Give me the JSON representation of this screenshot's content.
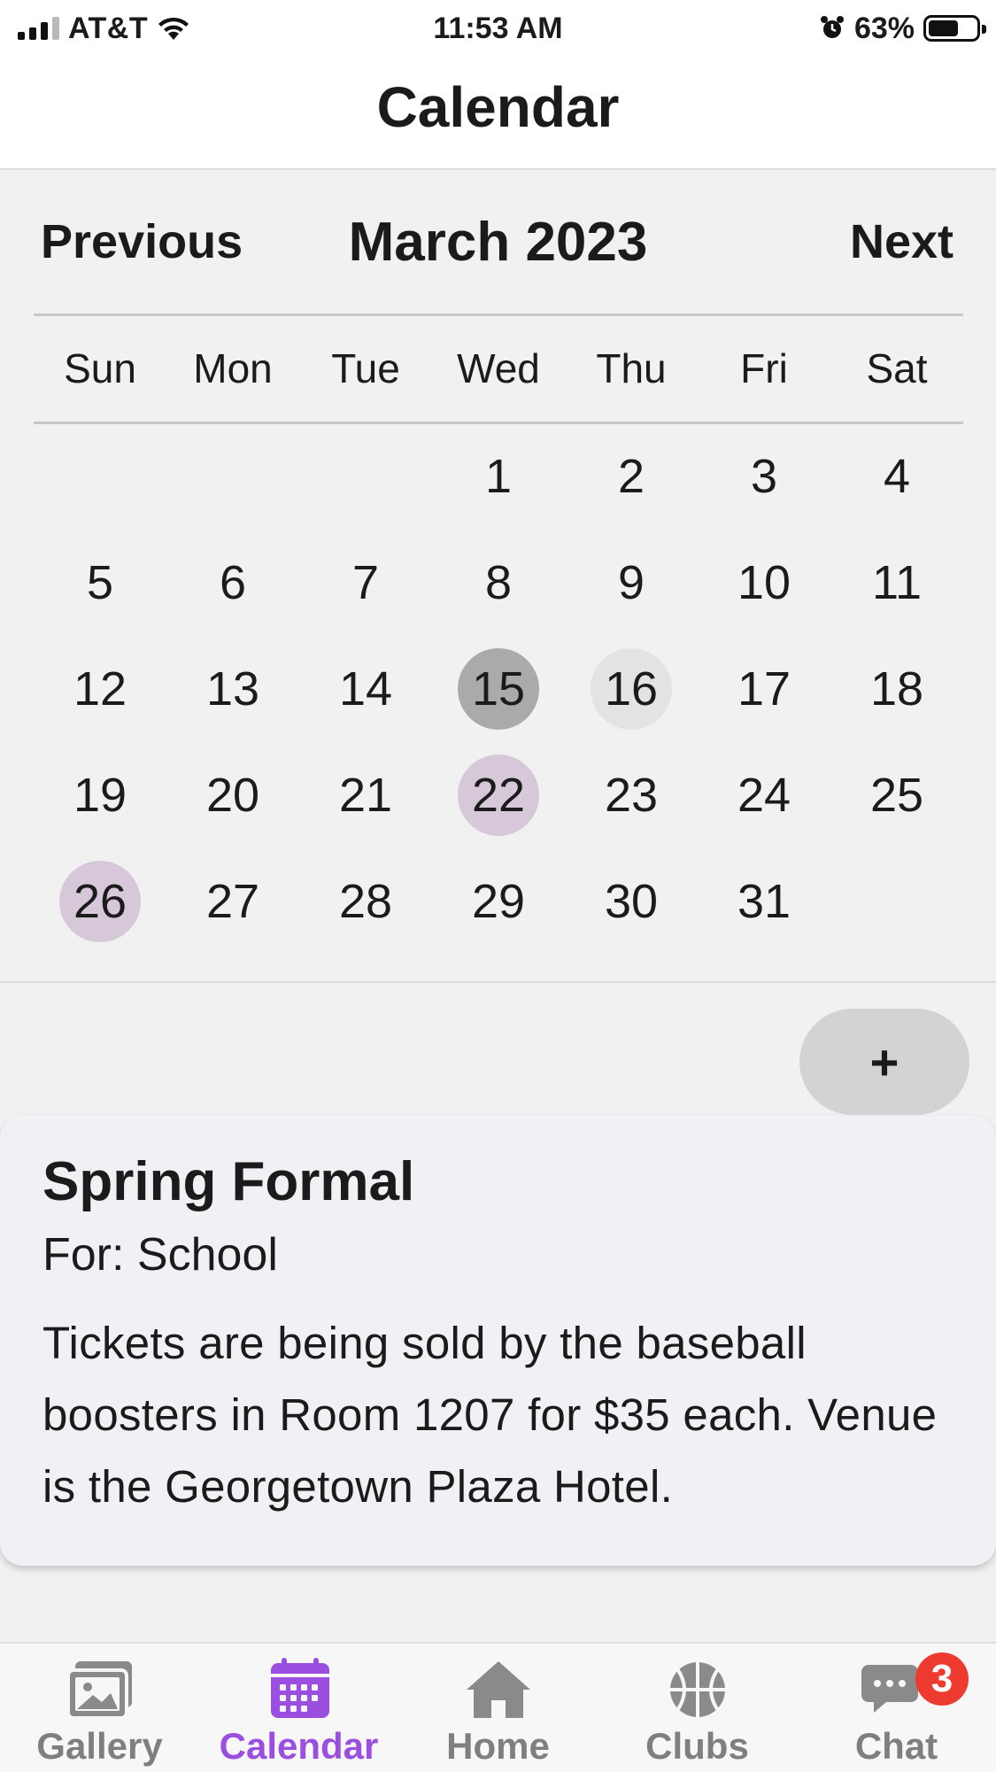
{
  "status": {
    "carrier": "AT&T",
    "time": "11:53 AM",
    "battery_percent": "63%",
    "battery_level": 0.63
  },
  "header": {
    "title": "Calendar"
  },
  "calendar": {
    "previous_label": "Previous",
    "month_label": "March 2023",
    "next_label": "Next",
    "weekdays": [
      "Sun",
      "Mon",
      "Tue",
      "Wed",
      "Thu",
      "Fri",
      "Sat"
    ],
    "first_weekday_index": 3,
    "days_in_month": 31,
    "today": 15,
    "selected": 16,
    "event_days": [
      22,
      26
    ]
  },
  "add_button": {
    "label": "+"
  },
  "event": {
    "title": "Spring Formal",
    "for": "For: School",
    "description": "Tickets are being sold by the baseball boosters in Room 1207 for $35 each. Venue is the Georgetown Plaza Hotel."
  },
  "tabs": [
    {
      "label": "Gallery",
      "icon": "gallery-icon",
      "active": false
    },
    {
      "label": "Calendar",
      "icon": "calendar-icon",
      "active": true
    },
    {
      "label": "Home",
      "icon": "home-icon",
      "active": false
    },
    {
      "label": "Clubs",
      "icon": "basketball-icon",
      "active": false
    },
    {
      "label": "Chat",
      "icon": "chat-icon",
      "active": false,
      "badge": "3"
    }
  ],
  "colors": {
    "accent": "#9a4fe0",
    "today_bg": "#aaaaaa",
    "selected_bg": "#e3e3e3",
    "event_bg": "#d6c8d8",
    "badge": "#ee3b30"
  }
}
